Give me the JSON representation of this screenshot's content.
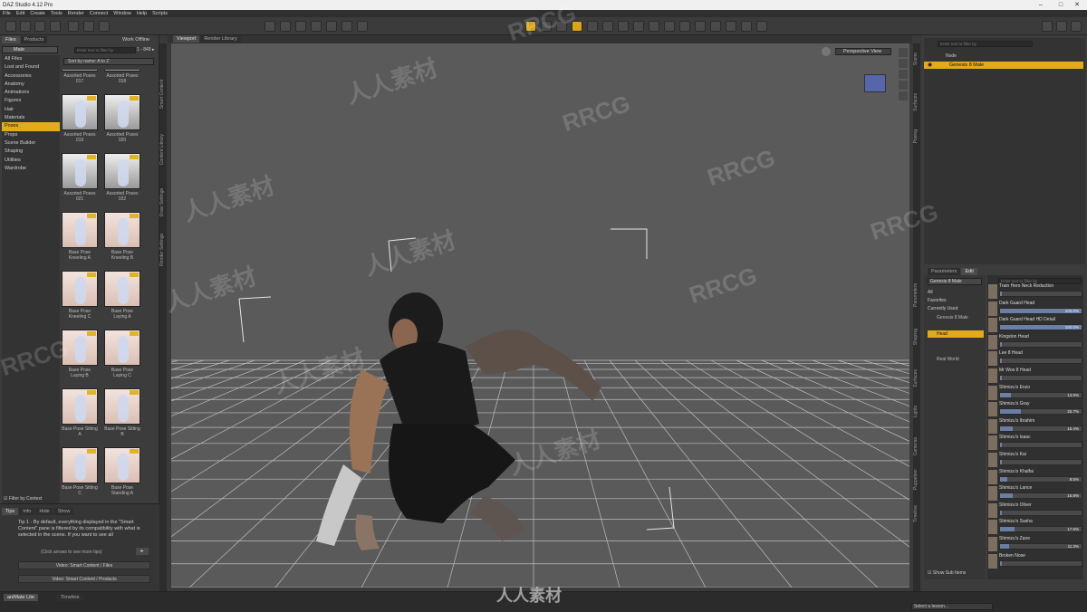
{
  "window": {
    "title": "DAZ Studio 4.12 Pro"
  },
  "menu": [
    "File",
    "Edit",
    "Create",
    "Tools",
    "Render",
    "Connect",
    "Window",
    "Help",
    "Scripts"
  ],
  "left": {
    "tabs": [
      "Files",
      "Products"
    ],
    "work_offline": "Work Offline",
    "filter_dropdown": "Male",
    "all_files": "All Files",
    "search_placeholder": "Enter text to filter by",
    "count": "1 - 849 ▸",
    "sort": "Sort by name: A to Z",
    "categories": [
      "Lost and Found",
      "Accessories",
      "Anatomy",
      "Animations",
      "Figures",
      "Hair",
      "Materials",
      "Poses",
      "Props",
      "Scene Builder",
      "Shaping",
      "Utilities",
      "Wardrobe"
    ],
    "selected_category": "Poses",
    "filter_by_context": "Filter by Context",
    "thumbs": [
      {
        "label": "Assorted Poses 017"
      },
      {
        "label": "Assorted Poses 018"
      },
      {
        "label": "Assorted Poses 019"
      },
      {
        "label": "Assorted Poses 020"
      },
      {
        "label": "Assorted Poses 021"
      },
      {
        "label": "Assorted Poses 022"
      },
      {
        "label": "Base Pose Kneeling A"
      },
      {
        "label": "Base Pose Kneeling B"
      },
      {
        "label": "Base Pose Kneeling C"
      },
      {
        "label": "Base Pose Laying A"
      },
      {
        "label": "Base Pose Laying B"
      },
      {
        "label": "Base Pose Laying C"
      },
      {
        "label": "Base Pose Sitting A"
      },
      {
        "label": "Base Pose Sitting B"
      },
      {
        "label": "Base Pose Sitting C"
      },
      {
        "label": "Base Pose Standing A"
      }
    ],
    "tips_tabs": [
      "Tips",
      "Info",
      "Hide",
      "Show"
    ],
    "tip_text": "Tip 1 - By default, everything displayed in the \"Smart Content\" pane is filtered by its compatibility with what is selected in the scene. If you want to see all",
    "tip_nav": "(Click arrows to see more tips)",
    "video1": "Video: Smart Content / Files",
    "video2": "Video: Smart Content / Products",
    "side_tabs": [
      "Smart Content",
      "Content Library",
      "Draw Settings",
      "Render Settings"
    ]
  },
  "viewport": {
    "tabs": [
      "Viewport",
      "Render Library"
    ],
    "camera": "Perspective View"
  },
  "right": {
    "scene_search": "Enter text to filter by",
    "node_header": "Node",
    "selected_node": "Genesis 8 Male",
    "param_tabs": [
      "Parameters",
      "Edit"
    ],
    "figure_dd": "Genesis 8 Male",
    "filters": [
      "All",
      "Favorites",
      "Currently Used"
    ],
    "tree": [
      {
        "label": "Genesis 8 Male",
        "sel": false
      },
      {
        "label": "Head",
        "sel": true
      },
      {
        "label": "",
        "sel": false
      },
      {
        "label": "",
        "sel": false
      },
      {
        "label": "Real World",
        "sel": false
      }
    ],
    "morph_search": "Enter text to filter by",
    "morphs": [
      {
        "name": "Train Hero Neck Reduction",
        "pct": "",
        "fill": 0
      },
      {
        "name": "Dark Guard Head",
        "pct": "100.0%",
        "fill": 1.0
      },
      {
        "name": "Dark Guard Head HD Detail",
        "pct": "100.0%",
        "fill": 1.0
      },
      {
        "name": "Kingston Head",
        "pct": "",
        "fill": 0
      },
      {
        "name": "Lee 8 Head",
        "pct": "",
        "fill": 0
      },
      {
        "name": "Mr Woo 8 Head",
        "pct": "",
        "fill": 0
      },
      {
        "name": "Shimizu's Enzo",
        "pct": "13.0%",
        "fill": 0.13
      },
      {
        "name": "Shimizu's Gray",
        "pct": "25.7%",
        "fill": 0.257
      },
      {
        "name": "Shimizu's Ibrahim",
        "pct": "15.4%",
        "fill": 0.154
      },
      {
        "name": "Shimizu's Isaac",
        "pct": "",
        "fill": 0
      },
      {
        "name": "Shimizu's Kai",
        "pct": "",
        "fill": 0
      },
      {
        "name": "Shimizu's Khalfai",
        "pct": "8.5%",
        "fill": 0.085
      },
      {
        "name": "Shimizu's Lance",
        "pct": "15.8%",
        "fill": 0.158
      },
      {
        "name": "Shimizu's Oliver",
        "pct": "",
        "fill": 0
      },
      {
        "name": "Shimizu's Sasha",
        "pct": "17.5%",
        "fill": 0.175
      },
      {
        "name": "Shimizu's Zane",
        "pct": "11.3%",
        "fill": 0.113
      },
      {
        "name": "Broken Nose",
        "pct": "",
        "fill": 0
      }
    ],
    "show_sub_items": "Show Sub Items",
    "side_tabs_top": [
      "Scene",
      "Surfaces",
      "Posing"
    ],
    "side_tabs_bottom": [
      "Parameters",
      "Shaping",
      "Surfaces",
      "Lights",
      "Cameras",
      "Puppeteer",
      "Timeline"
    ]
  },
  "status": {
    "left_tab": "aniMate Lite",
    "timeline_tab": "Timeline",
    "right_select": "Select a lesson..."
  },
  "watermarks": [
    "RRCG",
    "人人素材",
    "RRCG",
    "人人素材",
    "RRCG",
    "人人素材",
    "RRCG",
    "人人素材",
    "RRCG",
    "人人素材",
    "RRCG",
    "人人素材"
  ],
  "brand_bottom": "人人素材",
  "colors": {
    "accent": "#e3ab1b",
    "panel": "#3c3c3c",
    "viewport": "#5a5a5a"
  }
}
